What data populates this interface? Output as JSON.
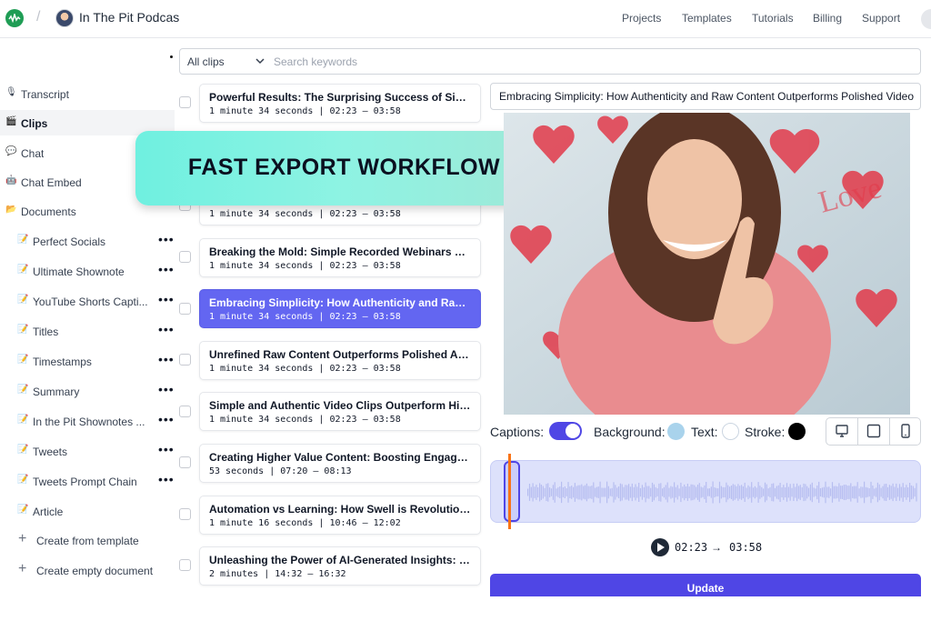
{
  "header": {
    "title": "In The Pit Podcas",
    "nav": [
      "Projects",
      "Templates",
      "Tutorials",
      "Billing",
      "Support"
    ]
  },
  "sidebar": {
    "items": [
      {
        "label": "Transcript",
        "icon": "microphone-icon"
      },
      {
        "label": "Clips",
        "icon": "clapperboard-icon",
        "active": true
      },
      {
        "label": "Chat",
        "icon": "chat-bubble-icon"
      },
      {
        "label": "Chat Embed",
        "icon": "robot-icon"
      },
      {
        "label": "Documents",
        "icon": "folder-icon"
      }
    ],
    "documents": [
      "Perfect Socials",
      "Ultimate Shownote",
      "YouTube Shorts Capti...",
      "Titles",
      "Timestamps",
      "Summary",
      "In the Pit Shownotes ...",
      "Tweets",
      "Tweets Prompt Chain",
      "Article"
    ],
    "actions": [
      "Create from template",
      "Create empty document"
    ]
  },
  "filter": {
    "selected": "All clips",
    "search_placeholder": "Search keywords"
  },
  "clips": [
    {
      "title": "Powerful Results: The Surprising Success of Simpl...",
      "meta": "1 minute 34 seconds | 02:23 – 03:58"
    },
    {
      "title": "",
      "meta": "1 minute 34 seconds | 02:23 – 03:58"
    },
    {
      "title": "Breaking the Mold: Simple Recorded Webinars Out...",
      "meta": "1 minute 34 seconds | 02:23 – 03:58"
    },
    {
      "title": "Embracing Simplicity: How Authenticity and Raw C...",
      "meta": "1 minute 34 seconds | 02:23 – 03:58",
      "selected": true
    },
    {
      "title": "Unrefined Raw Content Outperforms Polished Ani...",
      "meta": "1 minute 34 seconds | 02:23 – 03:58"
    },
    {
      "title": "Simple and Authentic Video Clips Outperform High...",
      "meta": "1 minute 34 seconds | 02:23 – 03:58"
    },
    {
      "title": "Creating Higher Value Content: Boosting Engagem...",
      "meta": "53 seconds | 07:20 – 08:13"
    },
    {
      "title": "Automation vs Learning: How Swell is Revolutionizi...",
      "meta": "1 minute 16 seconds | 10:46 – 12:02"
    },
    {
      "title": "Unleashing the Power of AI-Generated Insights: Re...",
      "meta": "2 minutes | 14:32 – 16:32"
    }
  ],
  "banner": {
    "text": "FAST EXPORT WORKFLOW"
  },
  "editor": {
    "clip_title": "Embracing Simplicity: How Authenticity and Raw Content Outperforms Polished Video",
    "captions_label": "Captions:",
    "captions_on": true,
    "background_label": "Background:",
    "text_label": "Text:",
    "stroke_label": "Stroke:",
    "colors": {
      "background": "#a9d3ec",
      "text": "#ffffff",
      "stroke": "#000000",
      "accent": "#4f46e5",
      "playhead": "#f97316"
    },
    "view_icons": [
      "desktop-icon",
      "square-icon",
      "mobile-icon"
    ],
    "start_time": "02:23",
    "end_time": "03:58",
    "update_label": "Update"
  }
}
